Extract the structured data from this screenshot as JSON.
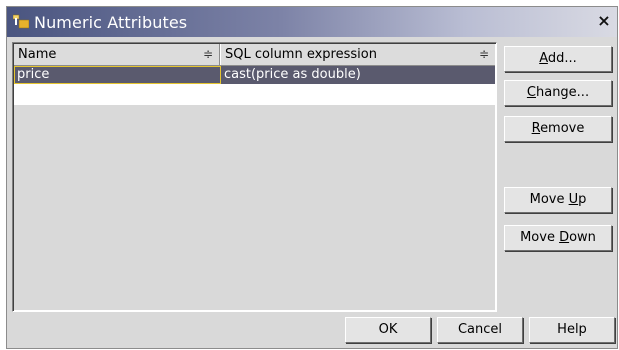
{
  "window": {
    "title": "Numeric Attributes",
    "close_glyph": "×",
    "icon": "folder-icon"
  },
  "table": {
    "columns": [
      "Name",
      "SQL column expression"
    ],
    "sort_glyph": "≑",
    "rows": [
      {
        "name": "price",
        "sql": "cast(price as double)"
      }
    ]
  },
  "side_buttons": {
    "add": {
      "pre": "",
      "u": "A",
      "post": "dd..."
    },
    "change": {
      "pre": "",
      "u": "C",
      "post": "hange..."
    },
    "remove": {
      "pre": "",
      "u": "R",
      "post": "emove"
    },
    "move_up": {
      "pre": "Move ",
      "u": "U",
      "post": "p"
    },
    "move_down": {
      "pre": "Move ",
      "u": "D",
      "post": "own"
    }
  },
  "bottom_buttons": {
    "ok": "OK",
    "cancel": "Cancel",
    "help": "Help"
  },
  "colors": {
    "title_start": "#4a5580",
    "selection": "#5a5a6e",
    "focus_border": "#e5c530",
    "dialog_bg": "#d9d9d9"
  }
}
